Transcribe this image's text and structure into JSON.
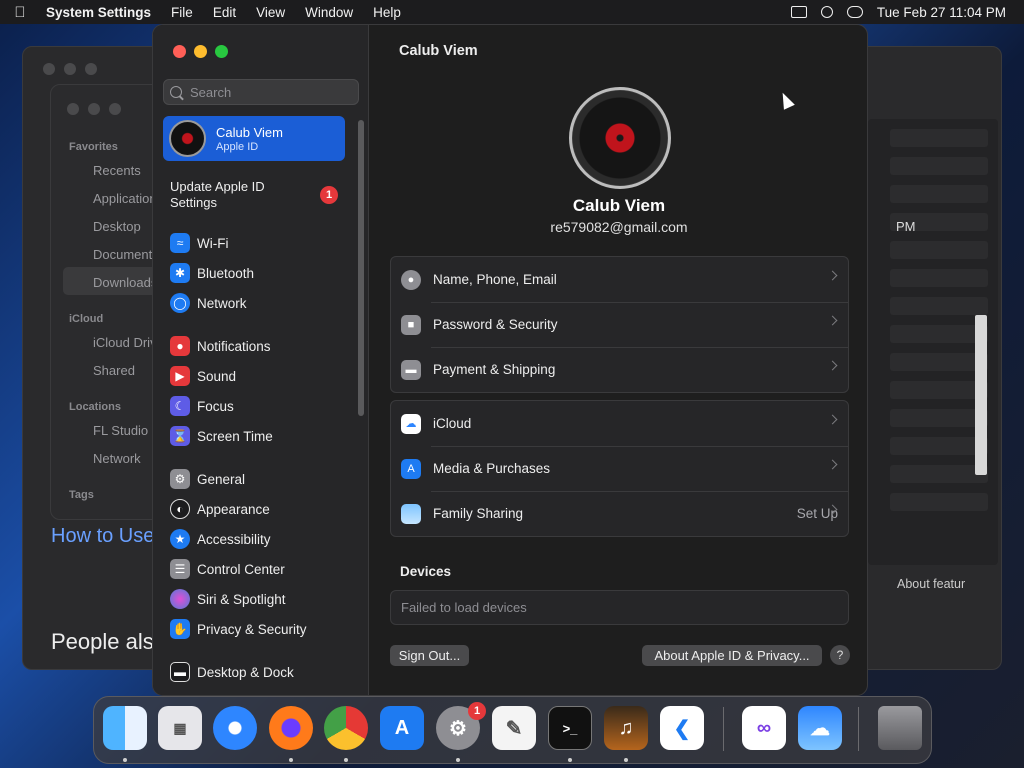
{
  "menubar": {
    "app": "System Settings",
    "items": [
      "File",
      "Edit",
      "View",
      "Window",
      "Help"
    ],
    "datetime": "Tue Feb 27  11:04 PM"
  },
  "background": {
    "finder": {
      "favorites": "Favorites",
      "recents": "Recents",
      "applications": "Applications",
      "desktop": "Desktop",
      "documents": "Documents",
      "downloads": "Downloads",
      "icloud": "iCloud",
      "icloud_drive": "iCloud Drive",
      "shared": "Shared",
      "locations": "Locations",
      "fl_studio": "FL Studio",
      "network": "Network",
      "tags": "Tags"
    },
    "browser": {
      "pm": "PM",
      "how_to": "How to Use",
      "people": "People also",
      "about_feat": "About featur"
    }
  },
  "sidebar": {
    "search_placeholder": "Search",
    "account": {
      "name": "Calub Viem",
      "sub": "Apple ID"
    },
    "update_label": "Update Apple ID Settings",
    "update_badge": "1",
    "items": [
      {
        "label": "Wi-Fi",
        "color": "#1e7bf2"
      },
      {
        "label": "Bluetooth",
        "color": "#1e7bf2"
      },
      {
        "label": "Network",
        "color": "#1e7bf2"
      },
      {
        "label": "Notifications",
        "color": "#e5383b"
      },
      {
        "label": "Sound",
        "color": "#e5383b"
      },
      {
        "label": "Focus",
        "color": "#5e5ce6"
      },
      {
        "label": "Screen Time",
        "color": "#5e5ce6"
      },
      {
        "label": "General",
        "color": "#8e8e93"
      },
      {
        "label": "Appearance",
        "color": "#1c1c1e"
      },
      {
        "label": "Accessibility",
        "color": "#1e7bf2"
      },
      {
        "label": "Control Center",
        "color": "#8e8e93"
      },
      {
        "label": "Siri & Spotlight",
        "color": "#b04fd6"
      },
      {
        "label": "Privacy & Security",
        "color": "#1e7bf2"
      },
      {
        "label": "Desktop & Dock",
        "color": "#1c1c1e"
      }
    ]
  },
  "content": {
    "title": "Calub Viem",
    "name": "Calub Viem",
    "email": "re579082@gmail.com",
    "group1": [
      {
        "label": "Name, Phone, Email"
      },
      {
        "label": "Password & Security"
      },
      {
        "label": "Payment & Shipping"
      }
    ],
    "group2": [
      {
        "label": "iCloud"
      },
      {
        "label": "Media & Purchases"
      },
      {
        "label": "Family Sharing",
        "value": "Set Up"
      }
    ],
    "devices_title": "Devices",
    "devices_status": "Failed to load devices",
    "sign_out": "Sign Out...",
    "about": "About Apple ID & Privacy...",
    "help": "?"
  },
  "dock": {
    "settings_badge": "1",
    "apps": [
      "Finder",
      "Launchpad",
      "Safari",
      "Firefox",
      "Chrome",
      "App Store",
      "System Settings",
      "TextEdit",
      "Terminal",
      "GarageBand",
      "VS Code",
      "Visual Studio",
      "Weather",
      "Trash"
    ]
  }
}
